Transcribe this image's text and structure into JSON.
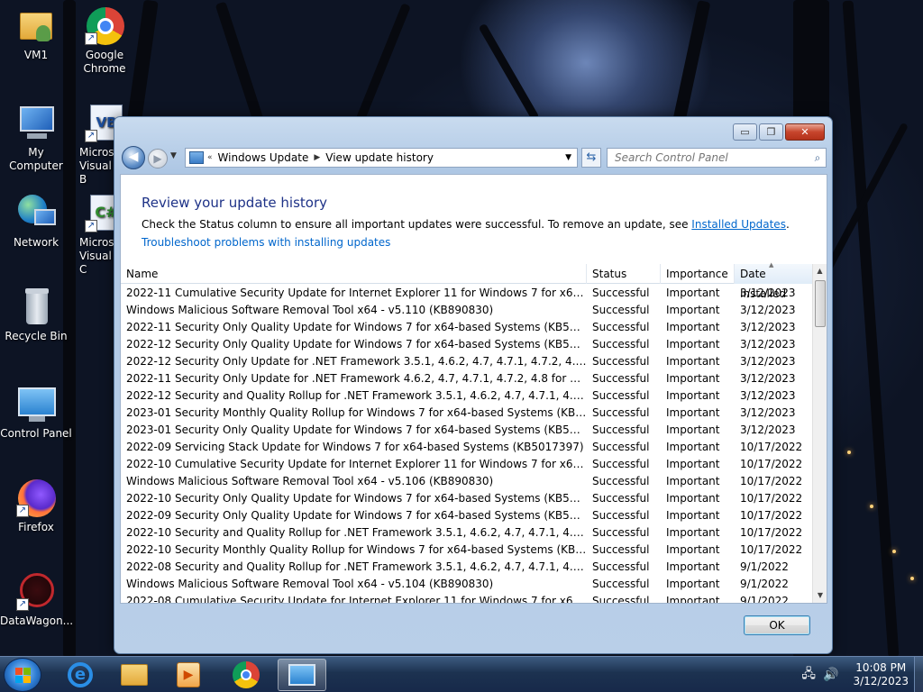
{
  "desktop": {
    "icons": [
      {
        "label": "VM1",
        "icon": "folder-icon"
      },
      {
        "label": "Google Chrome",
        "icon": "chrome-icon"
      },
      {
        "label": "My Computer",
        "icon": "computer-icon"
      },
      {
        "label": "Micros Visual B",
        "icon": "visual-basic-icon"
      },
      {
        "label": "Network",
        "icon": "network-icon"
      },
      {
        "label": "Micros Visual C",
        "icon": "visual-csharp-icon"
      },
      {
        "label": "Recycle Bin",
        "icon": "recycle-bin-icon"
      },
      {
        "label": "Control Panel",
        "icon": "control-panel-icon"
      },
      {
        "label": "Firefox",
        "icon": "firefox-icon"
      },
      {
        "label": "DataWagon...",
        "icon": "datawagon-icon"
      }
    ]
  },
  "window": {
    "caption_buttons": {
      "minimize": "▭",
      "maximize": "❐",
      "close": "✕"
    },
    "breadcrumb": [
      "Windows Update",
      "View update history"
    ],
    "search_placeholder": "Search Control Panel",
    "heading": "Review your update history",
    "description": "Check the Status column to ensure all important updates were successful. To remove an update, see",
    "installed_updates_link": "Installed Updates",
    "period": ".",
    "troubleshoot_link": "Troubleshoot problems with installing updates",
    "ok_label": "OK"
  },
  "table": {
    "columns": {
      "name": "Name",
      "status": "Status",
      "importance": "Importance",
      "date": "Date Installed"
    },
    "rows": [
      {
        "name": "2022-11 Cumulative Security Update for Internet Explorer 11 for Windows 7 for x64-based syste...",
        "status": "Successful",
        "importance": "Important",
        "date": "3/12/2023"
      },
      {
        "name": "Windows Malicious Software Removal Tool x64 - v5.110 (KB890830)",
        "status": "Successful",
        "importance": "Important",
        "date": "3/12/2023"
      },
      {
        "name": "2022-11 Security Only Quality Update for Windows 7 for x64-based Systems (KB5020013)",
        "status": "Successful",
        "importance": "Important",
        "date": "3/12/2023"
      },
      {
        "name": "2022-12 Security Only Quality Update for Windows 7 for x64-based Systems (KB5021288)",
        "status": "Successful",
        "importance": "Important",
        "date": "3/12/2023"
      },
      {
        "name": "2022-12 Security Only Update for .NET Framework 3.5.1, 4.6.2, 4.7, 4.7.1, 4.7.2, 4.8 for Windows ...",
        "status": "Successful",
        "importance": "Important",
        "date": "3/12/2023"
      },
      {
        "name": "2022-11 Security Only Update for .NET Framework 4.6.2, 4.7, 4.7.1, 4.7.2, 4.8 for Windows 7 for x...",
        "status": "Successful",
        "importance": "Important",
        "date": "3/12/2023"
      },
      {
        "name": "2022-12 Security and Quality Rollup for .NET Framework 3.5.1, 4.6.2, 4.7, 4.7.1, 4.7.2, 4.8 for Win...",
        "status": "Successful",
        "importance": "Important",
        "date": "3/12/2023"
      },
      {
        "name": "2023-01 Security Monthly Quality Rollup for Windows 7 for x64-based Systems (KB5022338)",
        "status": "Successful",
        "importance": "Important",
        "date": "3/12/2023"
      },
      {
        "name": "2023-01 Security Only Quality Update for Windows 7 for x64-based Systems (KB5022339)",
        "status": "Successful",
        "importance": "Important",
        "date": "3/12/2023"
      },
      {
        "name": "2022-09 Servicing Stack Update for Windows 7 for x64-based Systems (KB5017397)",
        "status": "Successful",
        "importance": "Important",
        "date": "10/17/2022"
      },
      {
        "name": "2022-10 Cumulative Security Update for Internet Explorer 11 for Windows 7 for x64-based syste...",
        "status": "Successful",
        "importance": "Important",
        "date": "10/17/2022"
      },
      {
        "name": "Windows Malicious Software Removal Tool x64 - v5.106 (KB890830)",
        "status": "Successful",
        "importance": "Important",
        "date": "10/17/2022"
      },
      {
        "name": "2022-10 Security Only Quality Update for Windows 7 for x64-based Systems (KB5018479)",
        "status": "Successful",
        "importance": "Important",
        "date": "10/17/2022"
      },
      {
        "name": "2022-09 Security Only Quality Update for Windows 7 for x64-based Systems (KB5017373)",
        "status": "Successful",
        "importance": "Important",
        "date": "10/17/2022"
      },
      {
        "name": "2022-10 Security and Quality Rollup for .NET Framework 3.5.1, 4.6.2, 4.7, 4.7.1, 4.7.2, 4.8 for Win...",
        "status": "Successful",
        "importance": "Important",
        "date": "10/17/2022"
      },
      {
        "name": "2022-10 Security Monthly Quality Rollup for Windows 7 for x64-based Systems (KB5018454)",
        "status": "Successful",
        "importance": "Important",
        "date": "10/17/2022"
      },
      {
        "name": "2022-08 Security and Quality Rollup for .NET Framework 3.5.1, 4.6.2, 4.7, 4.7.1, 4.7.2, 4.8 for Win...",
        "status": "Successful",
        "importance": "Important",
        "date": "9/1/2022"
      },
      {
        "name": "Windows Malicious Software Removal Tool x64 - v5.104 (KB890830)",
        "status": "Successful",
        "importance": "Important",
        "date": "9/1/2022"
      },
      {
        "name": "2022-08 Cumulative Security Update for Internet Explorer 11 for Windows 7 for x64-based syste...",
        "status": "Successful",
        "importance": "Important",
        "date": "9/1/2022"
      }
    ]
  },
  "taskbar": {
    "pinned": [
      "internet-explorer-icon",
      "file-explorer-icon",
      "media-player-icon",
      "chrome-icon",
      "control-panel-icon"
    ],
    "clock_time": "10:08 PM",
    "clock_date": "3/12/2023"
  },
  "colors": {
    "heading": "#1e3287",
    "link": "#0066cc",
    "taskbar": "#1c3250"
  }
}
